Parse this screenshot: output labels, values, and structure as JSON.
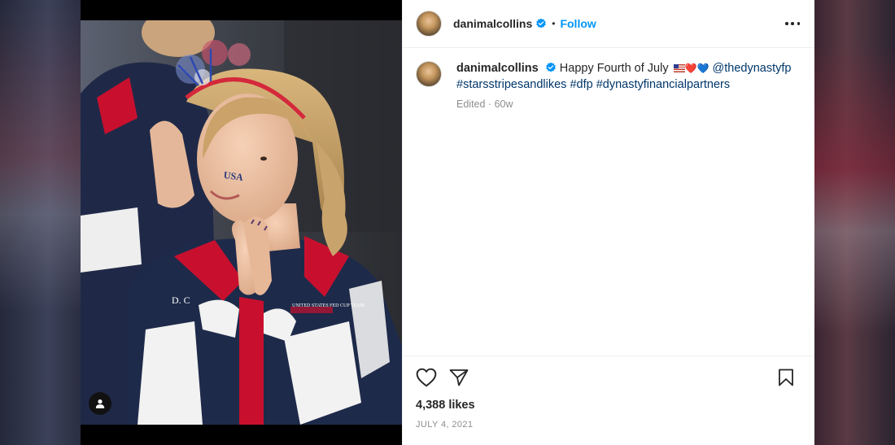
{
  "post": {
    "username": "danimalcollins",
    "follow_label": "Follow",
    "dot": "•",
    "caption": {
      "username": "danimalcollins",
      "text": "Happy Fourth of July",
      "emoji_hearts": "❤️💙",
      "mention": "@thedynastyfp",
      "hashtags": [
        "#starsstripesandlikes",
        "#dfp",
        "#dynastyfinancialpartners"
      ],
      "edited": "Edited",
      "sep": " · ",
      "age": "60w"
    },
    "likes": "4,388 likes",
    "date": "JULY 4, 2021"
  },
  "photo_lettering": {
    "face": "USA",
    "jacket_name": "D. C",
    "jacket_badge": "UNITED STATES FED CUP TEAM"
  },
  "colors": {
    "follow": "#0095f6",
    "link": "#00376b",
    "verified": "#0095f6",
    "muted": "#8e8e8e",
    "jacket": "#1e2a4a",
    "jacket_red": "#c8102e"
  },
  "icons": {
    "verified": "verified-badge-icon",
    "more": "more-options-icon",
    "like": "heart-icon",
    "share": "paper-plane-icon",
    "save": "bookmark-icon",
    "tag": "user-tag-icon"
  }
}
